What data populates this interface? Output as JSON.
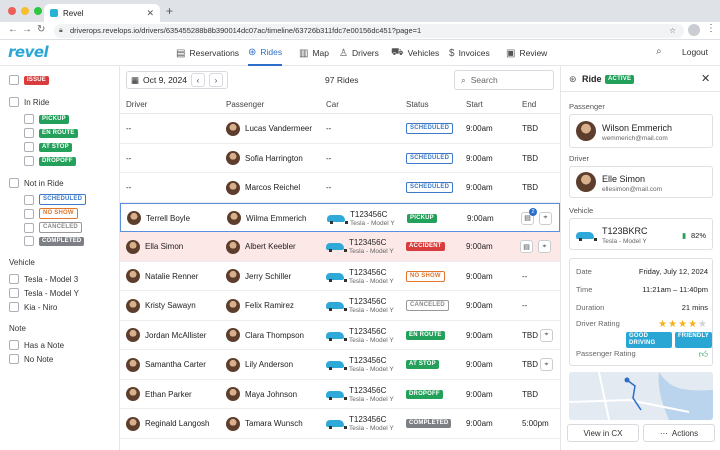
{
  "browser": {
    "tab_title": "Revel",
    "url": "driverops.revelops.io/drivers/635455288b8b390014dc07ac/timeline/63726b311fdc7e00156dc451?page=1"
  },
  "app": {
    "logo": "revel",
    "nav": [
      {
        "label": "Reservations",
        "icon": "reservations-icon"
      },
      {
        "label": "Rides",
        "icon": "steering-wheel-icon",
        "active": true
      },
      {
        "label": "Map",
        "icon": "map-icon"
      },
      {
        "label": "Drivers",
        "icon": "person-icon"
      },
      {
        "label": "Vehicles",
        "icon": "car-icon"
      },
      {
        "label": "Invoices",
        "icon": "dollar-icon"
      },
      {
        "label": "Review",
        "icon": "review-icon"
      }
    ],
    "logout": "Logout"
  },
  "filters": {
    "issue": "ISSUE",
    "in_ride": "In Ride",
    "in_ride_states": [
      "PICKUP",
      "EN ROUTE",
      "AT STOP",
      "DROPOFF"
    ],
    "not_in_ride": "Not in Ride",
    "not_in_ride_states": [
      "SCHEDULED",
      "NO SHOW",
      "CANCELED",
      "COMPLETED"
    ],
    "vehicle_title": "Vehicle",
    "vehicles": [
      "Tesla - Model 3",
      "Tesla - Model Y",
      "Kia - Niro"
    ],
    "note_title": "Note",
    "notes": [
      "Has a Note",
      "No Note"
    ]
  },
  "toolbar": {
    "date": "Oct 9, 2024",
    "count": "97 Rides",
    "search_placeholder": "Search"
  },
  "table": {
    "headers": [
      "Driver",
      "Passenger",
      "Car",
      "Status",
      "Start",
      "End"
    ],
    "rows": [
      {
        "driver": "--",
        "passenger": "Lucas Vandermeer",
        "car": "--",
        "car_model": "",
        "status": "SCHEDULED",
        "start": "9:00am",
        "end": "TBD"
      },
      {
        "driver": "--",
        "passenger": "Sofia Harrington",
        "car": "--",
        "car_model": "",
        "status": "SCHEDULED",
        "start": "9:00am",
        "end": "TBD"
      },
      {
        "driver": "--",
        "passenger": "Marcos Reichel",
        "car": "--",
        "car_model": "",
        "status": "SCHEDULED",
        "start": "9:00am",
        "end": "TBD"
      },
      {
        "driver": "Terrell Boyle",
        "passenger": "Wilma Emmerich",
        "car": "T123456C",
        "car_model": "Tesla - Model Y",
        "status": "PICKUP",
        "start": "9:00am",
        "end": "",
        "note_count": "2"
      },
      {
        "driver": "Ella Simon",
        "passenger": "Albert Keebler",
        "car": "T123456C",
        "car_model": "Tesla - Model Y",
        "status": "ACCIDENT",
        "start": "9:00am",
        "end": ""
      },
      {
        "driver": "Natalie Renner",
        "passenger": "Jerry Schiller",
        "car": "T123456C",
        "car_model": "Tesla - Model Y",
        "status": "NO SHOW",
        "start": "9:00am",
        "end": "--"
      },
      {
        "driver": "Kristy Sawayn",
        "passenger": "Felix Ramirez",
        "car": "T123456C",
        "car_model": "Tesla - Model Y",
        "status": "CANCELED",
        "start": "9:00am",
        "end": "--"
      },
      {
        "driver": "Jordan McAllister",
        "passenger": "Clara Thompson",
        "car": "T123456C",
        "car_model": "Tesla - Model Y",
        "status": "EN ROUTE",
        "start": "9:00am",
        "end": "TBD"
      },
      {
        "driver": "Samantha Carter",
        "passenger": "Lily Anderson",
        "car": "T123456C",
        "car_model": "Tesla - Model Y",
        "status": "AT STOP",
        "start": "9:00am",
        "end": "TBD"
      },
      {
        "driver": "Ethan Parker",
        "passenger": "Maya Johnson",
        "car": "T123456C",
        "car_model": "Tesla - Model Y",
        "status": "DROPOFF",
        "start": "9:00am",
        "end": "TBD"
      },
      {
        "driver": "Reginald Langosh",
        "passenger": "Tamara Wunsch",
        "car": "T123456C",
        "car_model": "Tesla - Model Y",
        "status": "COMPLETED",
        "start": "9:00am",
        "end": "5:00pm"
      }
    ]
  },
  "detail": {
    "title": "Ride",
    "badge": "ACTIVE",
    "passenger_label": "Passenger",
    "passenger_name": "Wilson Emmerich",
    "passenger_email": "wemmerich@mail.com",
    "driver_label": "Driver",
    "driver_name": "Elle Simon",
    "driver_email": "ellesimon@mail.com",
    "vehicle_label": "Vehicle",
    "vehicle_plate": "T123BKRC",
    "vehicle_model": "Tesla - Model Y",
    "battery": "82%",
    "date_label": "Date",
    "date": "Friday, July 12, 2024",
    "time_label": "Time",
    "time": "11:21am – 11:40pm",
    "duration_label": "Duration",
    "duration": "21 mins",
    "driver_rating_label": "Driver Rating",
    "driver_rating_stars": 4,
    "rating_tags": [
      "GOOD DRIVING",
      "FRIENDLY"
    ],
    "passenger_rating_label": "Passenger Rating",
    "view_in_cx": "View in CX",
    "actions": "Actions"
  }
}
